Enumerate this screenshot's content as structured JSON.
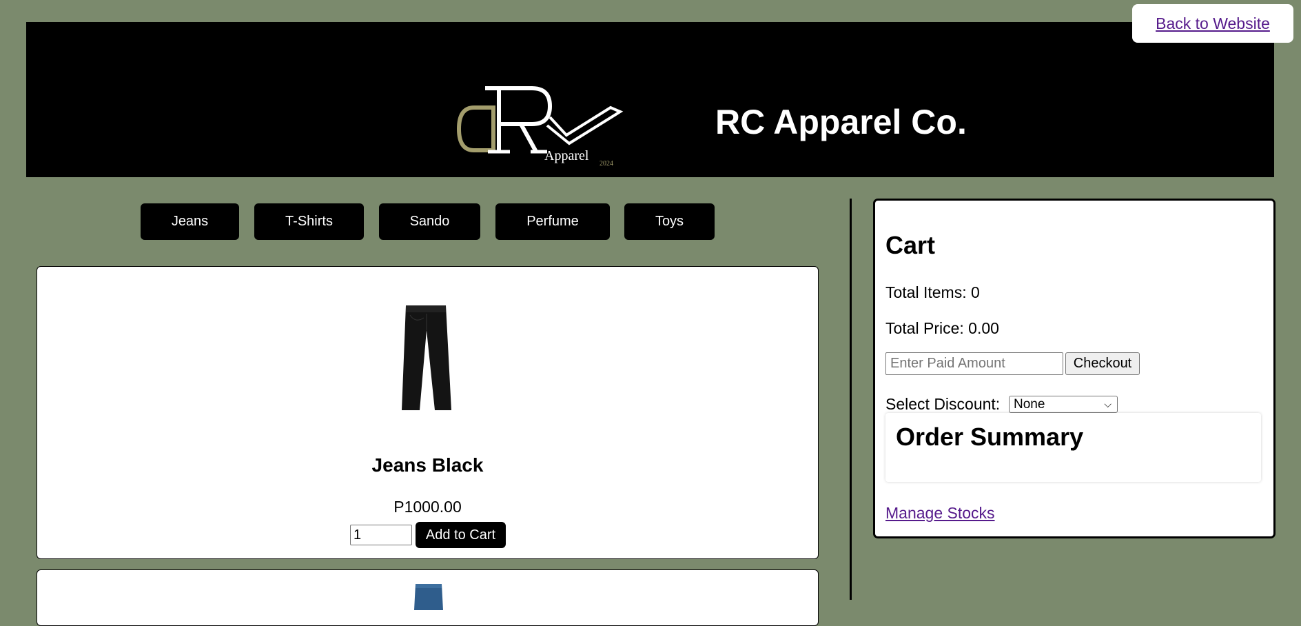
{
  "nav": {
    "back_link": "Back to Website"
  },
  "header": {
    "title": "RC Apparel Co.",
    "logo_text": "Apparel",
    "logo_year": "2024",
    "logo_gold": "#a39d6c"
  },
  "categories": [
    "Jeans",
    "T-Shirts",
    "Sando",
    "Perfume",
    "Toys"
  ],
  "products": [
    {
      "name": "Jeans Black",
      "price": "P1000.00",
      "quantity": "1",
      "add_label": "Add to Cart"
    },
    {
      "name": "",
      "price": "",
      "quantity": "",
      "add_label": ""
    }
  ],
  "cart": {
    "title": "Cart",
    "total_items": "Total Items: 0",
    "total_price": "Total Price: 0.00",
    "paid_placeholder": "Enter Paid Amount",
    "checkout_label": "Checkout",
    "discount_label": "Select Discount:",
    "discount_selected": "None",
    "summary_title": "Order Summary",
    "manage_link": "Manage Stocks"
  },
  "colors": {
    "page_background": "#7b8a6d",
    "header_background": "#000000",
    "button_background": "#000000",
    "link_color": "#551a8b"
  }
}
